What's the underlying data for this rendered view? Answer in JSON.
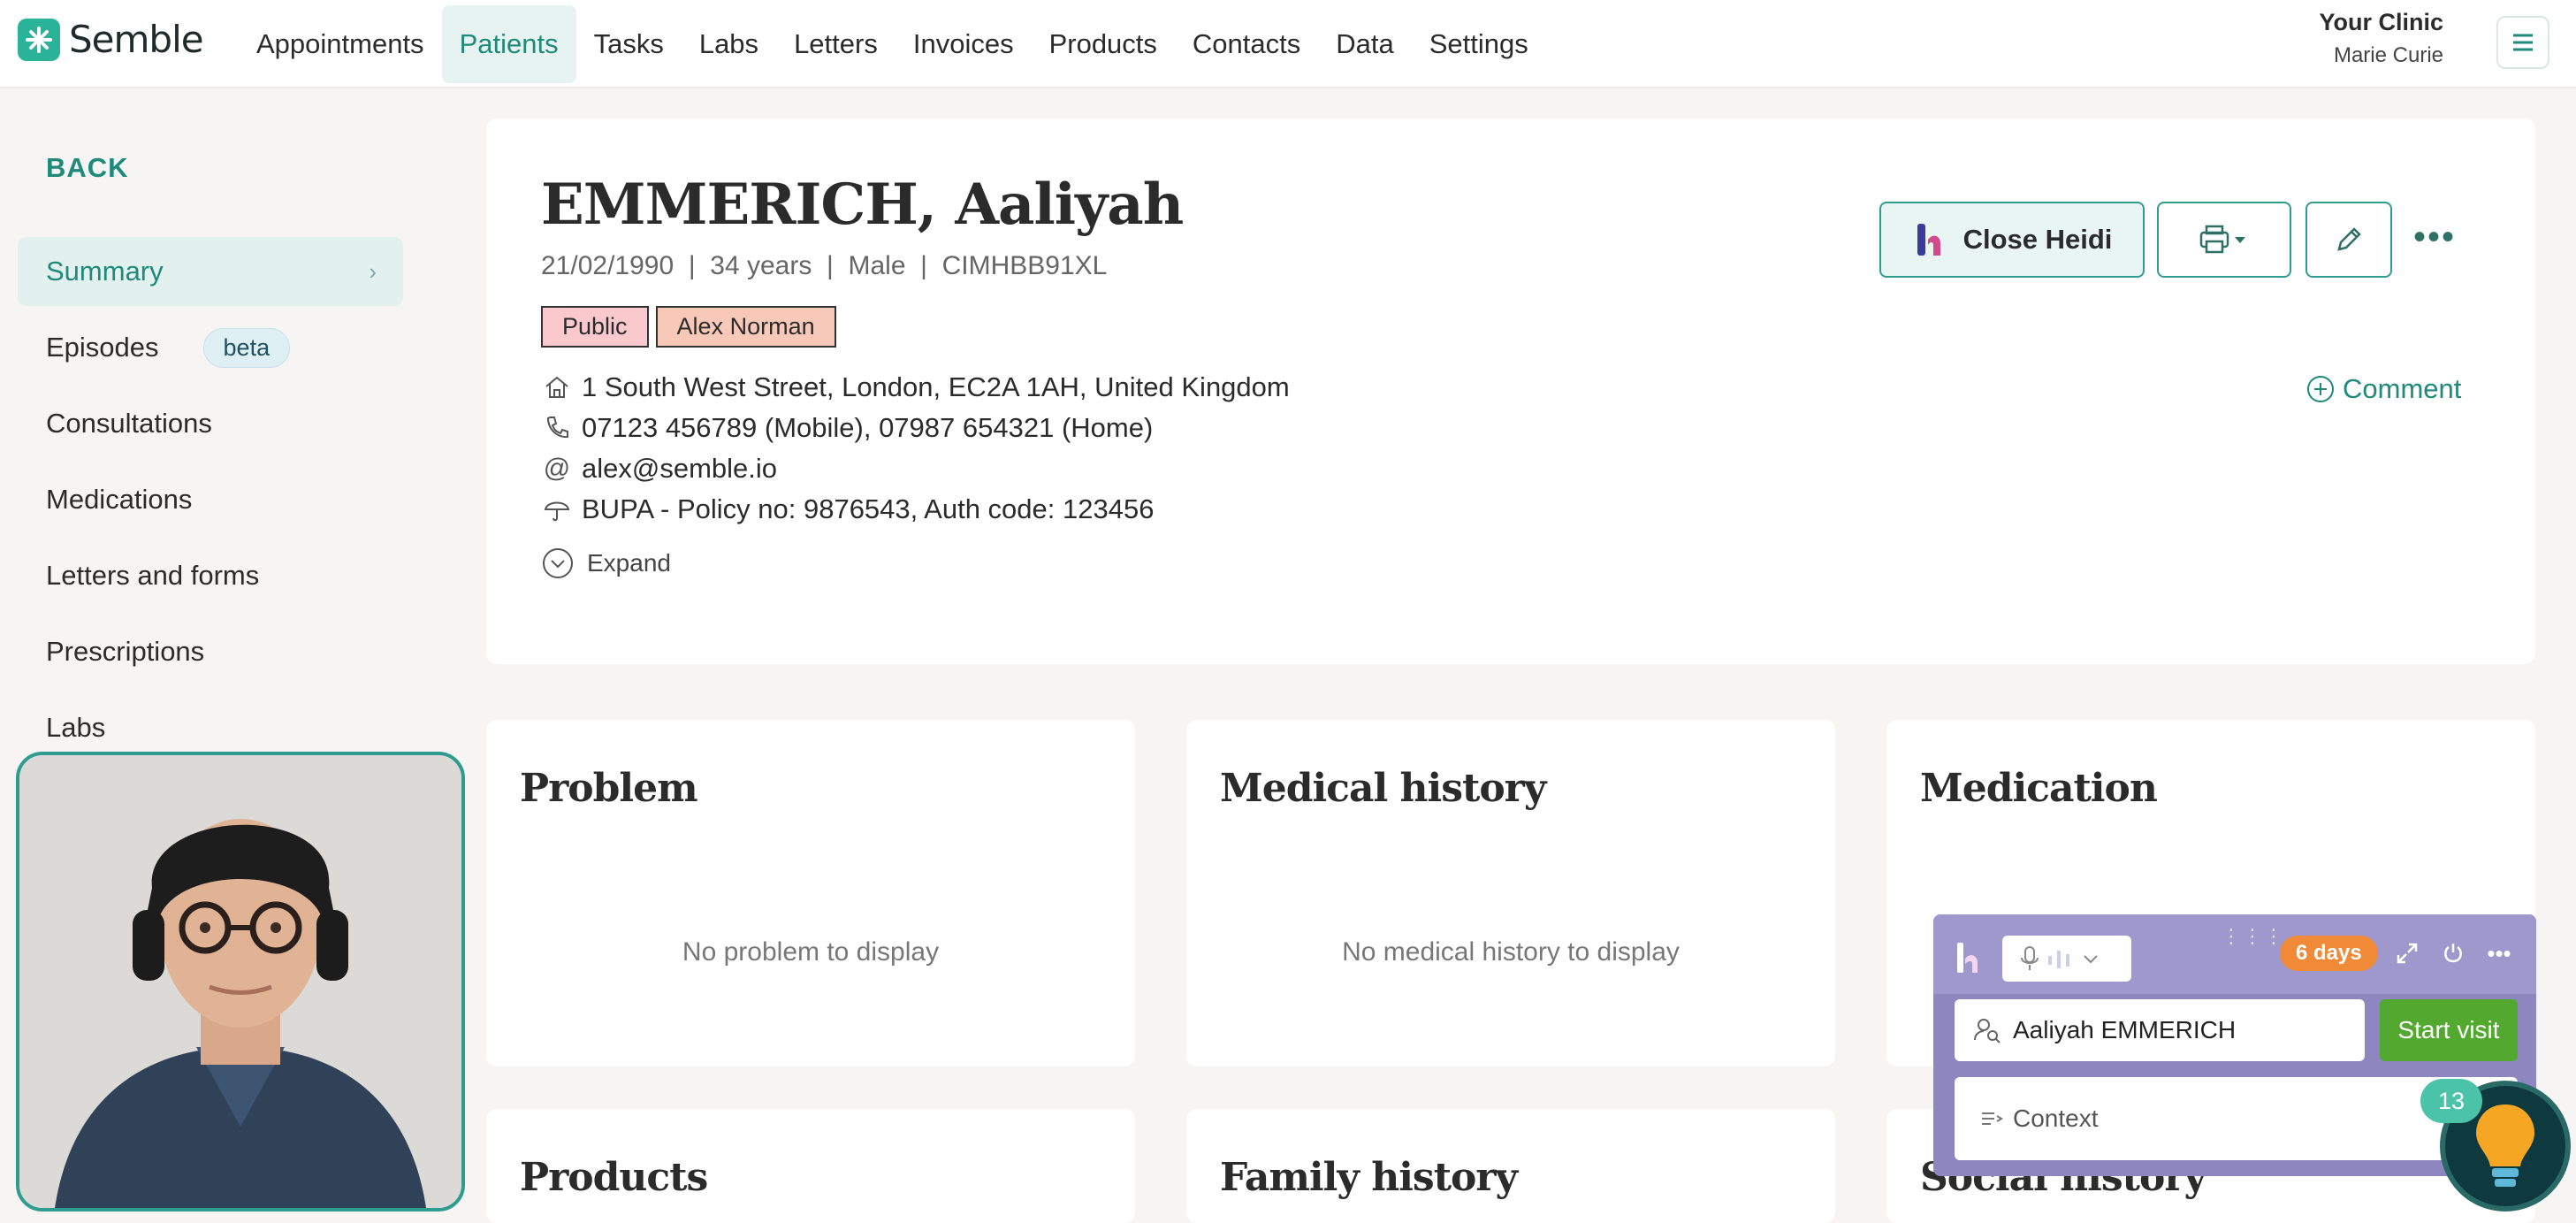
{
  "app": {
    "logo_text": "Semble"
  },
  "nav": {
    "items": [
      {
        "label": "Appointments",
        "active": false
      },
      {
        "label": "Patients",
        "active": true
      },
      {
        "label": "Tasks",
        "active": false
      },
      {
        "label": "Labs",
        "active": false
      },
      {
        "label": "Letters",
        "active": false
      },
      {
        "label": "Invoices",
        "active": false
      },
      {
        "label": "Products",
        "active": false
      },
      {
        "label": "Contacts",
        "active": false
      },
      {
        "label": "Data",
        "active": false
      },
      {
        "label": "Settings",
        "active": false
      }
    ],
    "clinic_name": "Your Clinic",
    "user_name": "Marie Curie"
  },
  "sidebar": {
    "back_label": "BACK",
    "items": [
      {
        "label": "Summary",
        "active": true
      },
      {
        "label": "Episodes",
        "badge": "beta"
      },
      {
        "label": "Consultations"
      },
      {
        "label": "Medications"
      },
      {
        "label": "Letters and forms"
      },
      {
        "label": "Prescriptions"
      },
      {
        "label": "Labs"
      }
    ]
  },
  "patient": {
    "name": "EMMERICH, Aaliyah",
    "meta": "21/02/1990  |  34 years  |  Male  |  CIMHBB91XL",
    "tags": [
      "Public",
      "Alex Norman"
    ],
    "address": "1 South West Street, London, EC2A 1AH, United Kingdom",
    "phone": "07123 456789 (Mobile), 07987 654321 (Home)",
    "email": "alex@semble.io",
    "insurance": "BUPA - Policy no: 9876543, Auth code: 123456",
    "expand_label": "Expand",
    "close_heidi_label": "Close Heidi",
    "comment_label": "Comment"
  },
  "sections": {
    "problem": {
      "title": "Problem",
      "empty": "No problem to display"
    },
    "medical_history": {
      "title": "Medical history",
      "empty": "No medical history to display"
    },
    "medication": {
      "title": "Medication"
    },
    "products": {
      "title": "Products"
    },
    "family_history": {
      "title": "Family history"
    },
    "social_history": {
      "title": "Social history"
    }
  },
  "heidi": {
    "days_badge": "6 days",
    "patient_field": "Aaliyah EMMERICH",
    "start_visit_label": "Start visit",
    "context_label": "Context",
    "notification_count": "13"
  },
  "colors": {
    "brand": "#2bb39a",
    "accent_text": "#1f8a7a",
    "heidi_panel": "#8d86bf",
    "start_visit": "#53a82f",
    "days_badge": "#f08a36"
  }
}
